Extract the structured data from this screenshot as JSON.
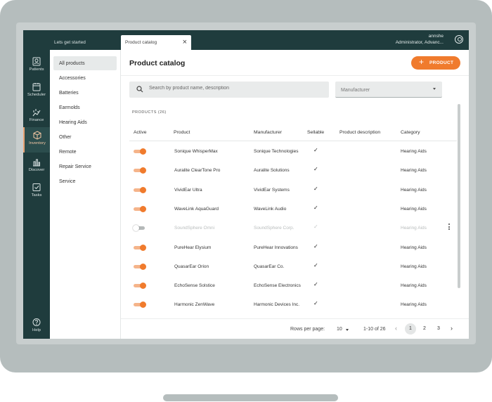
{
  "topbar": {
    "lets_started": "Lets get started",
    "tab_label": "Product catalog",
    "tab_close": "×",
    "user_name": "annshe",
    "user_role": "Administrator, Advanc..."
  },
  "rail": {
    "patients": "Patients",
    "scheduler": "Scheduler",
    "finance": "Finance",
    "inventory": "Inventory",
    "discover": "Discover",
    "tasks": "Tasks",
    "help": "Help"
  },
  "categories": [
    "All products",
    "Accessories",
    "Batteries",
    "Earmolds",
    "Hearing Aids",
    "Other",
    "Remote",
    "Repair Service",
    "Service"
  ],
  "main": {
    "title": "Product catalog",
    "add_label": "PRODUCT",
    "search_placeholder": "Search by product name, description",
    "manufacturer_label": "Manufacturer",
    "products_count": "PRODUCTS (26)"
  },
  "table": {
    "headers": [
      "Active",
      "Product",
      "Manufacturer",
      "Sellable",
      "Product description",
      "Category"
    ],
    "rows": [
      {
        "active": true,
        "product": "Sonique WhisperMax",
        "manufacturer": "Sonique Technologies",
        "sellable": "✓",
        "description": "",
        "category": "Hearing Aids"
      },
      {
        "active": true,
        "product": "Auralite ClearTone Pro",
        "manufacturer": "Auralite Solutions",
        "sellable": "✓",
        "description": "",
        "category": "Hearing Aids"
      },
      {
        "active": true,
        "product": "VividEar Ultra",
        "manufacturer": "VividEar Systems",
        "sellable": "✓",
        "description": "",
        "category": "Hearing Aids"
      },
      {
        "active": true,
        "product": "WaveLink AquaGuard",
        "manufacturer": "WaveLink Audio",
        "sellable": "✓",
        "description": "",
        "category": "Hearing Aids"
      },
      {
        "active": false,
        "product": "SoundSphere Omni",
        "manufacturer": "SoundSphere Corp.",
        "sellable": "✓",
        "description": "",
        "category": "Hearing Aids"
      },
      {
        "active": true,
        "product": "PureHear Elysium",
        "manufacturer": "PureHear Innovations",
        "sellable": "✓",
        "description": "",
        "category": "Hearing Aids"
      },
      {
        "active": true,
        "product": "QuasarEar Orion",
        "manufacturer": "QuasarEar Co.",
        "sellable": "✓",
        "description": "",
        "category": "Hearing Aids"
      },
      {
        "active": true,
        "product": "EchoSense Solstice",
        "manufacturer": "EchoSense Electronics",
        "sellable": "✓",
        "description": "",
        "category": "Hearing Aids"
      },
      {
        "active": true,
        "product": "Harmonic ZenWave",
        "manufacturer": "Harmonic Devices Inc.",
        "sellable": "✓",
        "description": "",
        "category": "Hearing Aids"
      }
    ]
  },
  "footer": {
    "rows_per_page_label": "Rows per page:",
    "rows_per_page_value": "10",
    "range": "1-10 of 26",
    "pages": [
      "1",
      "2",
      "3"
    ],
    "current_page": "1",
    "prev": "‹",
    "next": "›"
  },
  "colors": {
    "accent": "#f07b2d",
    "rail": "#1f3c3d"
  }
}
